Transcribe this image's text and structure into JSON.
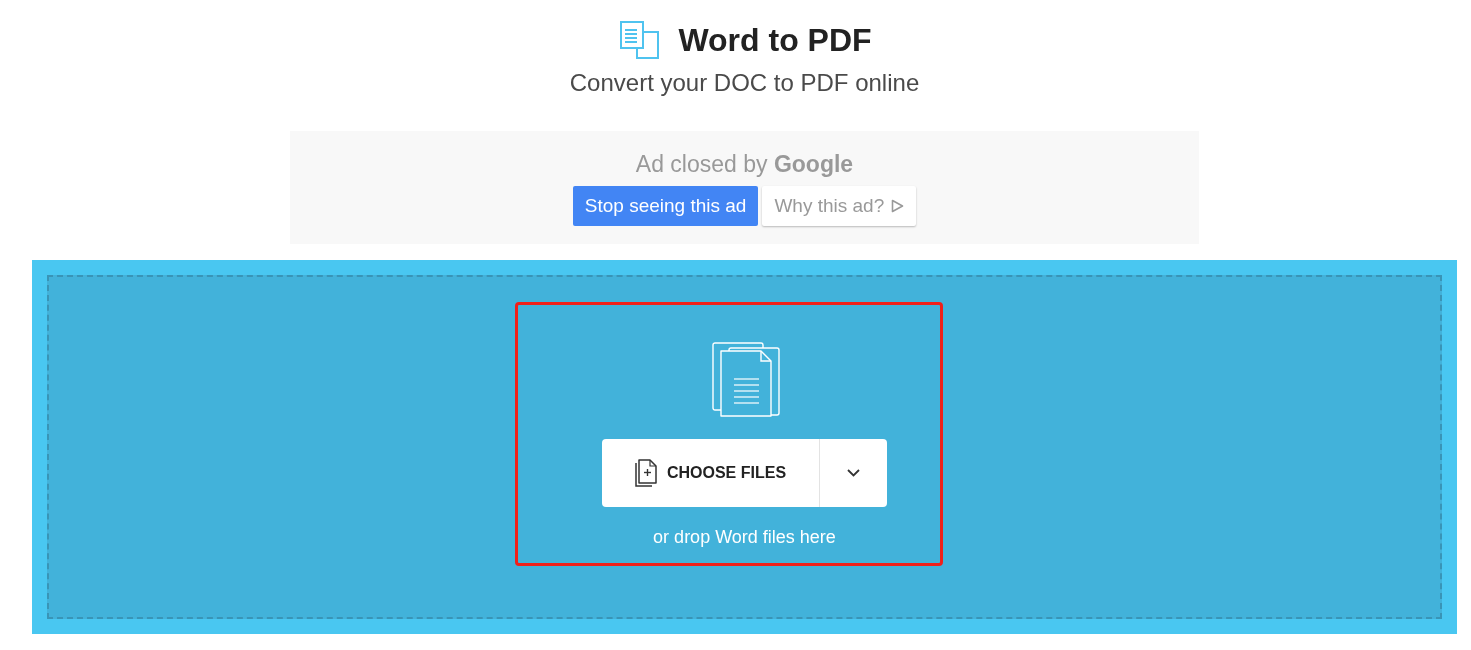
{
  "header": {
    "title": "Word to PDF",
    "subtitle": "Convert your DOC to PDF online"
  },
  "ad": {
    "message": "Ad closed by **Google**",
    "buttons": [
      {
        "label": "Stop seeing this ad",
        "kind": "primary"
      },
      {
        "label": "Why this ad?",
        "kind": "secondary"
      }
    ]
  },
  "upload": {
    "highlighted": true,
    "button": {
      "label": "CHOOSE FILES"
    },
    "hint": "or drop Word files here"
  }
}
